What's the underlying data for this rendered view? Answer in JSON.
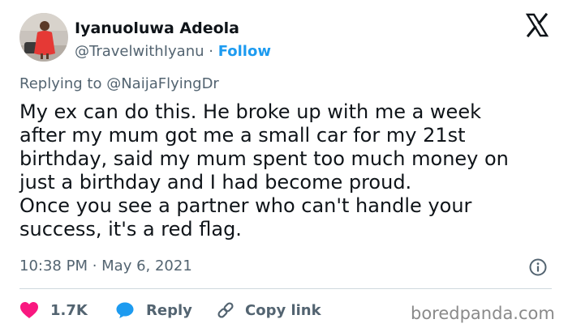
{
  "author": {
    "display_name": "Iyanuoluwa Adeola",
    "handle": "@TravelwithIyanu",
    "separator": " · ",
    "follow_label": "Follow",
    "avatar": "avatar-woman-red-dress"
  },
  "platform_icon": "x-logo-icon",
  "reply_context": {
    "prefix": "Replying to ",
    "mention": "@NaijaFlyingDr"
  },
  "tweet": {
    "lines": [
      "My ex can do this. He broke up with me a week",
      "after my mum got me a small car for my 21st",
      "birthday, said my mum spent too much money on",
      "just a birthday and I had become proud.",
      "Once you see a partner who can't handle your",
      "success, it's a red flag."
    ],
    "timestamp": "10:38 PM · May 6, 2021"
  },
  "actions": {
    "like_count": "1.7K",
    "reply_label": "Reply",
    "copy_label": "Copy link"
  },
  "watermark": "boredpanda.com",
  "colors": {
    "text": "#0f1419",
    "secondary": "#536471",
    "link_blue": "#1d9bf0",
    "heart_red": "#f91880",
    "reply_blue": "#1d9bf0",
    "divider": "#cfd9de"
  }
}
